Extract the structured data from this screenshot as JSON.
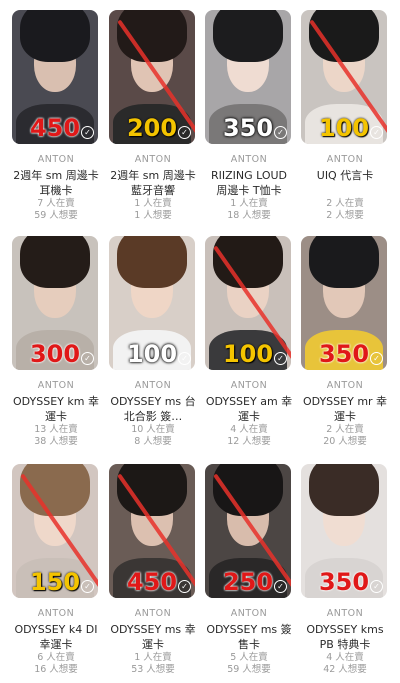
{
  "cards": [
    {
      "brand": "ANTON",
      "title": "2週年 sm 周邊卡 耳機卡",
      "price": "450",
      "price_color": "red",
      "struck": false,
      "for_sale": "7 人在賣",
      "wanted": "59 人想要",
      "bg": "#4a4a52",
      "hair": "#1a1a1e",
      "face": "#d9bfb0",
      "body": "#2b2b30"
    },
    {
      "brand": "ANTON",
      "title": "2週年 sm 周邊卡 藍牙音響",
      "price": "200",
      "price_color": "yellow",
      "struck": true,
      "for_sale": "1 人在賣",
      "wanted": "1 人想要",
      "bg": "#5a4a48",
      "hair": "#221a18",
      "face": "#e0c4b4",
      "body": "#2a2a2a"
    },
    {
      "brand": "ANTON",
      "title": "RIIZING LOUD 周邊卡 T恤卡",
      "price": "350",
      "price_color": "white",
      "struck": false,
      "for_sale": "1 人在賣",
      "wanted": "18 人想要",
      "bg": "#a8a6a8",
      "hair": "#1c1c1e",
      "face": "#efdcd2",
      "body": "#7a7878"
    },
    {
      "brand": "ANTON",
      "title": "UIQ 代言卡",
      "price": "100",
      "price_color": "yellow",
      "struck": true,
      "for_sale": "2 人在賣",
      "wanted": "2 人想要",
      "bg": "#c9c4c0",
      "hair": "#1a1a1a",
      "face": "#ecd6c8",
      "body": "#e8e4e0"
    },
    {
      "brand": "ANTON",
      "title": "ODYSSEY km 幸運卡",
      "price": "300",
      "price_color": "red",
      "struck": false,
      "for_sale": "13 人在賣",
      "wanted": "38 人想要",
      "bg": "#c8c2bc",
      "hair": "#241c18",
      "face": "#e6cdbd",
      "body": "#b8b0a8"
    },
    {
      "brand": "ANTON",
      "title": "ODYSSEY ms 台北合影 簽…",
      "price": "100",
      "price_color": "white",
      "struck": false,
      "for_sale": "10 人在賣",
      "wanted": "8 人想要",
      "bg": "#d8cfc8",
      "hair": "#5a3a26",
      "face": "#efd6c6",
      "body": "#f2f2f2"
    },
    {
      "brand": "ANTON",
      "title": "ODYSSEY am 幸運卡",
      "price": "100",
      "price_color": "yellow",
      "struck": true,
      "for_sale": "4 人在賣",
      "wanted": "12 人想要",
      "bg": "#c9c0ba",
      "hair": "#221a16",
      "face": "#ead2c4",
      "body": "#3a3a3c"
    },
    {
      "brand": "ANTON",
      "title": "ODYSSEY mr 幸運卡",
      "price": "350",
      "price_color": "red",
      "struck": false,
      "for_sale": "2 人在賣",
      "wanted": "20 人想要",
      "bg": "#9c8e86",
      "hair": "#1a1a1c",
      "face": "#e2c8b8",
      "body": "#e8c43a"
    },
    {
      "brand": "ANTON",
      "title": "ODYSSEY k4 DI 幸運卡",
      "price": "150",
      "price_color": "yellow",
      "struck": true,
      "for_sale": "6 人在賣",
      "wanted": "16 人想要",
      "bg": "#d2c6c0",
      "hair": "#8a6a4e",
      "face": "#efd8ca",
      "body": "#c9bfb8"
    },
    {
      "brand": "ANTON",
      "title": "ODYSSEY ms 幸運卡",
      "price": "450",
      "price_color": "red",
      "struck": true,
      "for_sale": "1 人在賣",
      "wanted": "53 人想要",
      "bg": "#6a5c56",
      "hair": "#1c1816",
      "face": "#dcc0b0",
      "body": "#3a3634"
    },
    {
      "brand": "ANTON",
      "title": "ODYSSEY ms 簽售卡",
      "price": "250",
      "price_color": "red",
      "struck": true,
      "for_sale": "5 人在賣",
      "wanted": "59 人想要",
      "bg": "#4c4644",
      "hair": "#181616",
      "face": "#d8bcac",
      "body": "#2a2828"
    },
    {
      "brand": "ANTON",
      "title": "ODYSSEY kms PB 特典卡",
      "price": "350",
      "price_color": "red",
      "struck": false,
      "for_sale": "4 人在賣",
      "wanted": "42 人想要",
      "bg": "#e4e0de",
      "hair": "#3a2c26",
      "face": "#f0ddd2",
      "body": "#d8d4d2"
    }
  ]
}
